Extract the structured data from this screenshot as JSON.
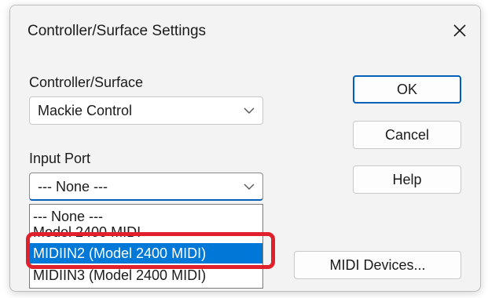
{
  "dialog": {
    "title": "Controller/Surface Settings",
    "close_glyph": "✕"
  },
  "controller_surface": {
    "label": "Controller/Surface",
    "value": "Mackie Control"
  },
  "input_port": {
    "label": "Input Port",
    "value": "--- None ---",
    "options": [
      "--- None ---",
      "Model 2400 MIDI",
      "MIDIIN2 (Model 2400 MIDI)",
      "MIDIIN3 (Model 2400 MIDI)"
    ],
    "highlighted_index": 2
  },
  "buttons": {
    "ok": "OK",
    "cancel": "Cancel",
    "help": "Help",
    "midi_devices": "MIDI Devices..."
  },
  "colors": {
    "accent": "#005fb8",
    "selection": "#0078d7",
    "annotation_box": "#e0202a"
  },
  "icons": {
    "close": "close-icon",
    "dropdown": "chevron-down-icon"
  }
}
